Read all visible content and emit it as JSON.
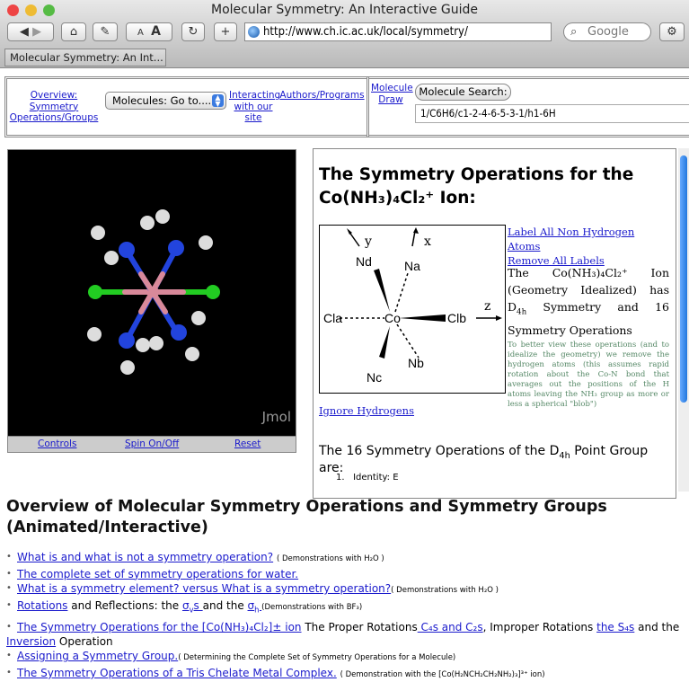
{
  "browser": {
    "window_title": "Molecular Symmetry: An Interactive Guide",
    "url": "http://www.ch.ic.ac.uk/local/symmetry/",
    "search_placeholder": "Google",
    "tab_label": "Molecular Symmetry: An Int...",
    "font_small": "A",
    "font_large": "A",
    "add": "+",
    "reload": "↻"
  },
  "nav": {
    "overview": "Overview: Symmetry Operations/Groups",
    "molecules_select": "Molecules: Go to....",
    "interacting": "Interacting with our site",
    "authors": "Authors/Programs",
    "molecule_draw": "Molecule Draw",
    "molecule_search": "Molecule Search:",
    "inchi_value": "1/C6H6/c1-2-4-6-5-3-1/h1-6H"
  },
  "jmol": {
    "label": "Jmol",
    "controls": "Controls",
    "spin": "Spin On/Off",
    "reset": "Reset"
  },
  "frame": {
    "heading_pre": "The Symmetry Operations for the",
    "heading_ion": "Co(NH₃)₄Cl₂⁺ Ion:",
    "label_all": "Label All Non Hydrogen Atoms",
    "remove_labels": "Remove All Labels",
    "desc_1": "The Co(NH₃)₄Cl₂⁺ Ion (Geometry Idealized) has D",
    "desc_sub": "4h",
    "desc_2": " Symmetry and 16 Symmetry Operations",
    "note": "To better view these operations (and to idealize the geometry) we remove the hydrogen atoms (this assumes rapid rotation about the Co-N bond that averages out the positions of the H atoms leaving the NH₃ group as more or less a spherical \"blob\")",
    "ignore_h": "Ignore Hydrogens",
    "ops_heading_1": "The 16 Symmetry Operations of the D",
    "ops_heading_sub": "4h",
    "ops_heading_2": " Point Group are:",
    "op1": "Identity: E",
    "diagram": {
      "y": "y",
      "x": "x",
      "z": "z",
      "Nd": "Nd",
      "Na": "Na",
      "Cla": "Cla",
      "Co": "Co",
      "Clb": "Clb",
      "Nc": "Nc",
      "Nb": "Nb"
    }
  },
  "overview": {
    "heading": "Overview of Molecular Symmetry Operations and Symmetry Groups (Animated/Interactive)",
    "items": [
      {
        "link": "What is and what is not a symmetry operation?",
        "note": "( Demonstrations with H₂O )"
      },
      {
        "link": "The complete set of symmetry operations for water.",
        "note": ""
      },
      {
        "link": "What is a symmetry element? versus What is a symmetry operation?",
        "note": "( Demonstrations with H₂O )"
      },
      {
        "link": "Rotations",
        "text1": " and Reflections: the ",
        "link2": "σ",
        "link2sub": "v",
        "link2b": "s ",
        "text2": "and the ",
        "link3": "σ",
        "link3sub": "h ",
        "note": "(Demonstrations with BF₃)"
      },
      {
        "link": "The Symmetry Operations for the [Co(NH₃)₄Cl₂]± ion",
        "text1": " The Proper Rotations",
        "link2": " C₄s and C₂s",
        "text2": ", Improper Rotations ",
        "link3": "the S₄s",
        "text3": " and the ",
        "link4": "Inversion",
        "text4": " Operation"
      },
      {
        "link": "Assigning a Symmetry Group.",
        "note": "( Determining the Complete Set of Symmetry Operations for a Molecule)"
      },
      {
        "link": "The Symmetry Operations of a Tris Chelate Metal Complex.",
        "note": "( Demonstration with the [Co(H₂NCH₂CH₂NH₂)₃]³⁺ ion)"
      }
    ]
  }
}
